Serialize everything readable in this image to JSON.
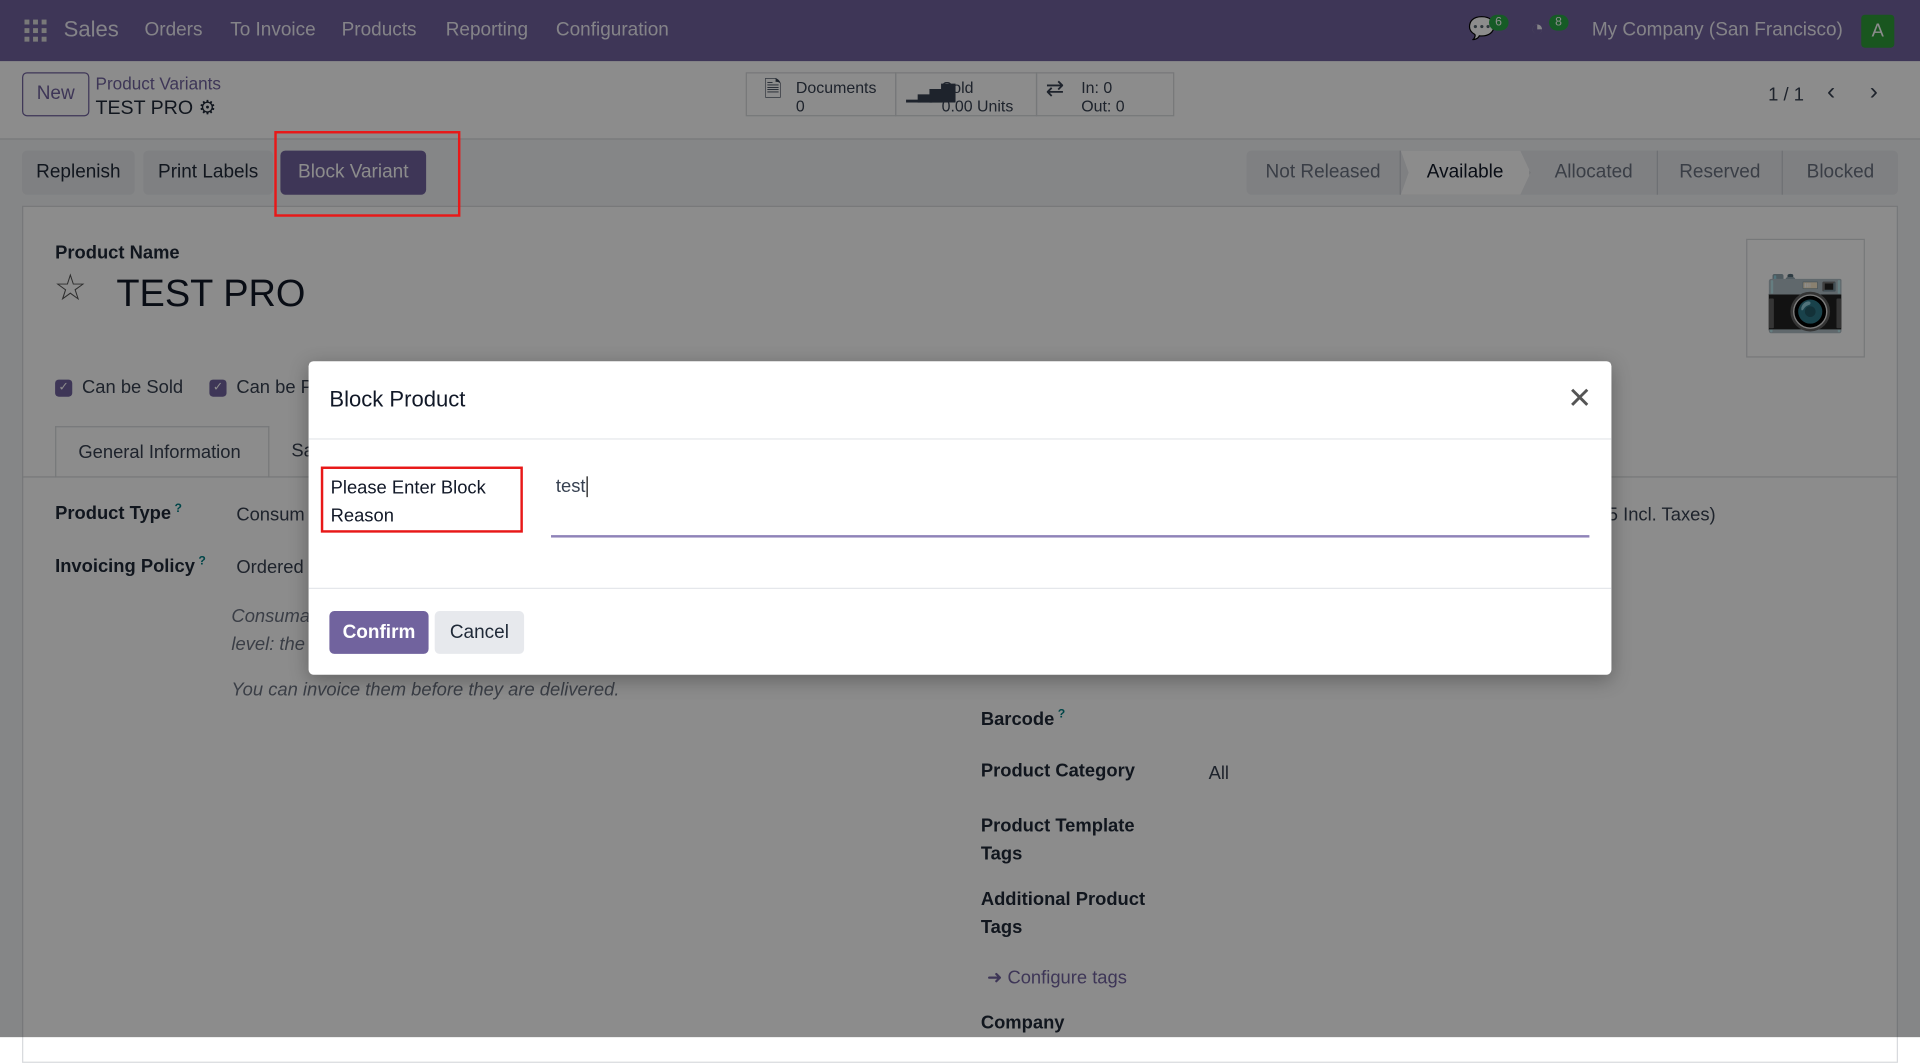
{
  "navbar": {
    "app": "Sales",
    "menu": [
      "Orders",
      "To Invoice",
      "Products",
      "Reporting",
      "Configuration"
    ],
    "messages_count": "6",
    "activities_count": "8",
    "company": "My Company (San Francisco)",
    "avatar": "A"
  },
  "control_panel": {
    "new_label": "New",
    "breadcrumb_parent": "Product Variants",
    "breadcrumb_current": "TEST PRO",
    "stats": {
      "documents_label": "Documents",
      "documents_value": "0",
      "sold_label": "Sold",
      "sold_value": "0.00 Units",
      "in_label": "In: 0",
      "out_label": "Out: 0"
    },
    "pager": "1 / 1"
  },
  "actions": {
    "replenish": "Replenish",
    "print_labels": "Print Labels",
    "block_variant": "Block Variant"
  },
  "statusbar": [
    "Not Released",
    "Available",
    "Allocated",
    "Reserved",
    "Blocked"
  ],
  "form": {
    "product_name_label": "Product Name",
    "product_name": "TEST PRO",
    "can_be_sold": "Can be Sold",
    "can_be_purchased": "Can be P",
    "tabs": [
      "General Information",
      "Sa"
    ],
    "product_type_label": "Product Type",
    "product_type_value": "Consum",
    "invoicing_policy_label": "Invoicing Policy",
    "invoicing_policy_value": "Ordered",
    "help_1": "Consuma",
    "help_2": "level: the",
    "help_3": "You can invoice them before they are delivered.",
    "price_suffix": "5 Incl. Taxes)",
    "barcode_label": "Barcode",
    "category_label": "Product Category",
    "category_value": "All",
    "template_tags_label": "Product Template Tags",
    "additional_tags_label": "Additional Product Tags",
    "configure_tags": "Configure tags",
    "company_label": "Company"
  },
  "modal": {
    "title": "Block Product",
    "field_label": "Please Enter Block Reason",
    "field_value": "test",
    "confirm": "Confirm",
    "cancel": "Cancel"
  }
}
